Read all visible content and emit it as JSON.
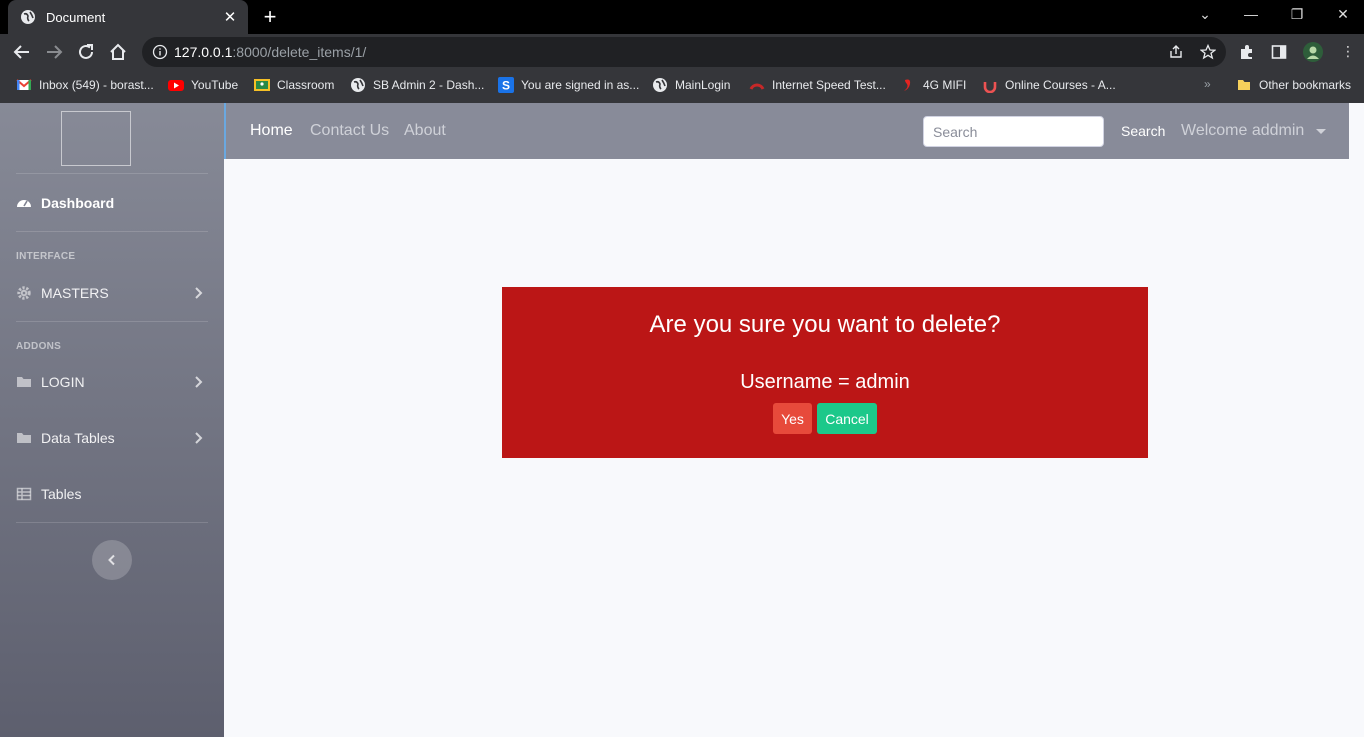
{
  "browser": {
    "tab_title": "Document",
    "url_host": "127.0.0.1",
    "url_path": ":8000/delete_items/1/",
    "bookmarks": [
      {
        "label": "Inbox (549) - borast...",
        "icon": "gmail-icon",
        "color": "#ea4335"
      },
      {
        "label": "YouTube",
        "icon": "youtube-icon",
        "color": "#ff0000"
      },
      {
        "label": "Classroom",
        "icon": "classroom-icon",
        "color": "#f6c026"
      },
      {
        "label": "SB Admin 2 - Dash...",
        "icon": "globe-icon",
        "color": "#e8eaed"
      },
      {
        "label": "You are signed in as...",
        "icon": "s-icon",
        "color": "#1a73e8"
      },
      {
        "label": "MainLogin",
        "icon": "globe-icon",
        "color": "#e8eaed"
      },
      {
        "label": "Internet Speed Test...",
        "icon": "speedometer-icon",
        "color": "#c62828"
      },
      {
        "label": "4G MIFI",
        "icon": "airtel-icon",
        "color": "#e52421"
      },
      {
        "label": "Online Courses - A...",
        "icon": "udemy-icon",
        "color": "#ec5252"
      }
    ],
    "other_bookmarks": "Other bookmarks"
  },
  "sidebar": {
    "dashboard": "Dashboard",
    "heading_interface": "INTERFACE",
    "masters": "MASTERS",
    "heading_addons": "ADDONS",
    "login": "LOGIN",
    "data_tables": "Data Tables",
    "tables": "Tables"
  },
  "topnav": {
    "home": "Home",
    "contact": "Contact Us",
    "about": "About",
    "search_placeholder": "Search",
    "search_button": "Search",
    "welcome": "Welcome addmin"
  },
  "dialog": {
    "title": "Are you sure you want to delete?",
    "username_line": "Username = admin",
    "yes": "Yes",
    "cancel": "Cancel",
    "bg_color": "#bb1616",
    "yes_color": "#e74a3b",
    "cancel_color": "#1cc88a"
  }
}
